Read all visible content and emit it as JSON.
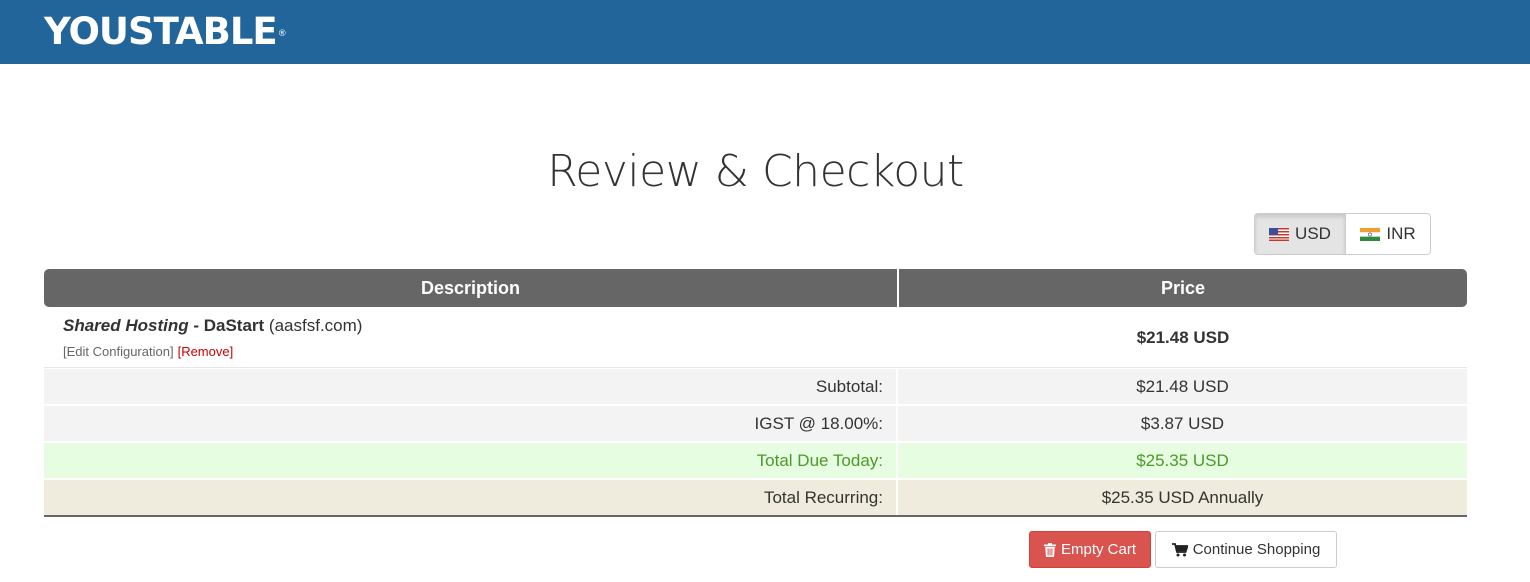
{
  "brand": {
    "logo_text": "YOUSTABLE",
    "registered_mark": "®",
    "bar_color": "#21659b"
  },
  "page": {
    "title": "Review & Checkout"
  },
  "currency": {
    "options": [
      {
        "code": "USD",
        "flag": "us-flag-icon",
        "selected": true
      },
      {
        "code": "INR",
        "flag": "india-flag-icon",
        "selected": false
      }
    ]
  },
  "cart": {
    "headers": {
      "description": "Description",
      "price": "Price"
    },
    "items": [
      {
        "product": "Shared Hosting",
        "separator": " - ",
        "plan": "DaStart",
        "domain": " (aasfsf.com)",
        "edit_label": "[Edit Configuration]",
        "remove_label": "[Remove]",
        "price": "$21.48 USD"
      }
    ],
    "summary": {
      "subtotal": {
        "label": "Subtotal:",
        "value": "$21.48 USD"
      },
      "tax": {
        "label": "IGST @ 18.00%:",
        "value": "$3.87 USD"
      },
      "total_due": {
        "label": "Total Due Today:",
        "value": "$25.35 USD",
        "color": "#4a9a2a"
      },
      "recurring": {
        "label": "Total Recurring:",
        "value": "$25.35 USD Annually"
      }
    }
  },
  "actions": {
    "empty_cart": {
      "label": "Empty Cart",
      "icon": "trash-icon",
      "color": "#d9534f"
    },
    "continue_shopping": {
      "label": "Continue Shopping",
      "icon": "cart-icon"
    }
  }
}
